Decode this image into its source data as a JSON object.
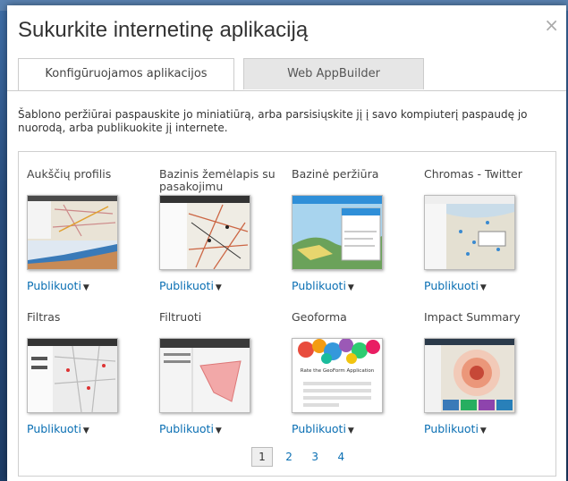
{
  "dialog": {
    "title": "Sukurkite internetinę aplikaciją",
    "close_glyph": "×"
  },
  "tabs": [
    {
      "label": "Konfigūruojamos aplikacijos",
      "active": true
    },
    {
      "label": "Web AppBuilder",
      "active": false
    }
  ],
  "description": "Šablono peržiūrai paspauskite jo miniatiūrą, arba parsisiųskite jį į savo kompiuterį paspaudę jo nuorodą, arba publikuokite jį internete.",
  "templates": [
    {
      "title": "Aukščių profilis",
      "publish": "Publikuoti",
      "icon": "chevron-down-icon"
    },
    {
      "title": "Bazinis žemėlapis su pasakojimu",
      "publish": "Publikuoti",
      "icon": "chevron-down-icon"
    },
    {
      "title": "Bazinė peržiūra",
      "publish": "Publikuoti",
      "icon": "chevron-down-icon"
    },
    {
      "title": "Chromas - Twitter",
      "publish": "Publikuoti",
      "icon": "chevron-down-icon"
    },
    {
      "title": "Filtras",
      "publish": "Publikuoti",
      "icon": "chevron-down-icon"
    },
    {
      "title": "Filtruoti",
      "publish": "Publikuoti",
      "icon": "chevron-down-icon"
    },
    {
      "title": "Geoforma",
      "publish": "Publikuoti",
      "icon": "chevron-down-icon"
    },
    {
      "title": "Impact Summary",
      "publish": "Publikuoti",
      "icon": "chevron-down-icon"
    }
  ],
  "thumb_text": {
    "geoform": "Rate the GeoForm Application"
  },
  "pagination": {
    "pages": [
      "1",
      "2",
      "3",
      "4"
    ],
    "current": "1"
  },
  "colors": {
    "link": "#0a6fb3",
    "accent_blue": "#2f8fd8"
  }
}
